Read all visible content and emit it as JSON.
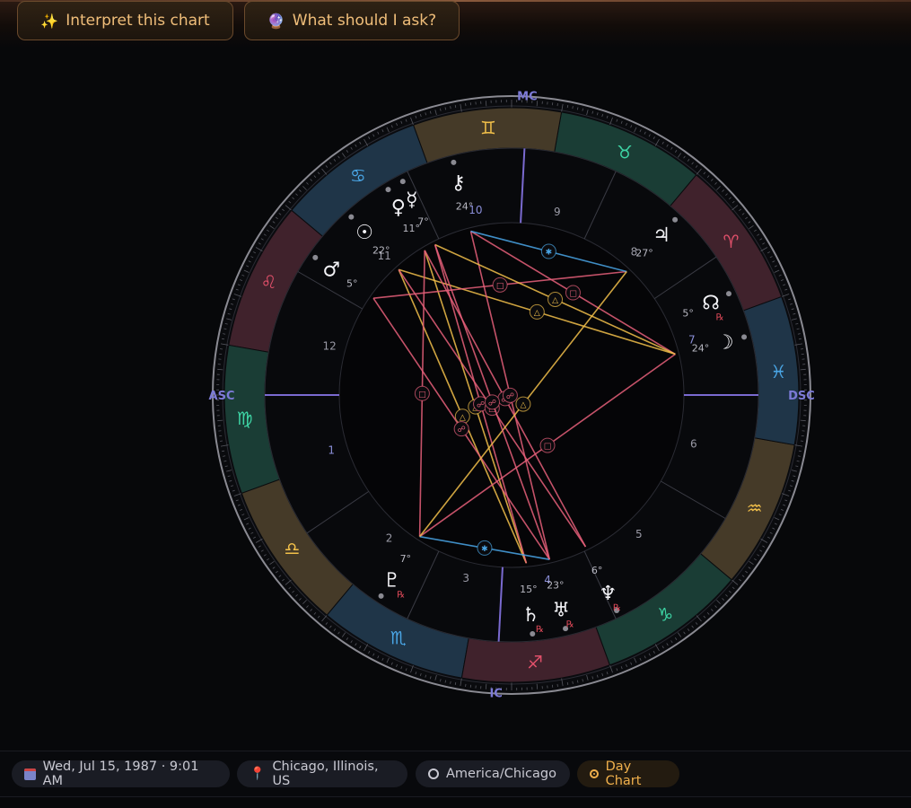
{
  "toolbar": {
    "interpret_icon": "✨",
    "interpret_label": "Interpret this chart",
    "ask_icon": "🔮",
    "ask_label": "What should I ask?"
  },
  "chart": {
    "axes": {
      "mc": "MC",
      "ic": "IC",
      "asc": "ASC",
      "dsc": "DSC"
    },
    "ascendant_longitude": 160,
    "mc_longitude": 67,
    "zodiac": [
      {
        "glyph": "♈",
        "color": "#e0506a",
        "fill": "#40222c"
      },
      {
        "glyph": "♉",
        "color": "#3ed6a6",
        "fill": "#1a3d35"
      },
      {
        "glyph": "♊",
        "color": "#f2c04a",
        "fill": "#453a28"
      },
      {
        "glyph": "♋",
        "color": "#4aa6e6",
        "fill": "#1f3548"
      },
      {
        "glyph": "♌",
        "color": "#e0506a",
        "fill": "#40222c"
      },
      {
        "glyph": "♍",
        "color": "#3ed6a6",
        "fill": "#1a3d35"
      },
      {
        "glyph": "♎",
        "color": "#f2c04a",
        "fill": "#453a28"
      },
      {
        "glyph": "♏",
        "color": "#4aa6e6",
        "fill": "#1f3548"
      },
      {
        "glyph": "♐",
        "color": "#e0506a",
        "fill": "#40222c"
      },
      {
        "glyph": "♑",
        "color": "#3ed6a6",
        "fill": "#1a3d35"
      },
      {
        "glyph": "♒",
        "color": "#f2c04a",
        "fill": "#453a28"
      },
      {
        "glyph": "♓",
        "color": "#4aa6e6",
        "fill": "#1f3548"
      }
    ],
    "houses": [
      {
        "n": "1",
        "color": "#8a8ed8"
      },
      {
        "n": "2",
        "color": "#9a9aa6"
      },
      {
        "n": "3",
        "color": "#9a9aa6"
      },
      {
        "n": "4",
        "color": "#8a8ed8"
      },
      {
        "n": "5",
        "color": "#9a9aa6"
      },
      {
        "n": "6",
        "color": "#9a9aa6"
      },
      {
        "n": "7",
        "color": "#8a8ed8"
      },
      {
        "n": "8",
        "color": "#9a9aa6"
      },
      {
        "n": "9",
        "color": "#9a9aa6"
      },
      {
        "n": "10",
        "color": "#8a8ed8"
      },
      {
        "n": "11",
        "color": "#9a9aa6"
      },
      {
        "n": "12",
        "color": "#9a9aa6"
      }
    ],
    "house_cusps": [
      160,
      194,
      225,
      247,
      275,
      310,
      340,
      14,
      45,
      67,
      95,
      130
    ],
    "planets": [
      {
        "name": "Sun",
        "glyph": "☉",
        "degree": "22°",
        "longitude": 112,
        "retro": false
      },
      {
        "name": "Moon",
        "glyph": "☽",
        "degree": "24°",
        "longitude": 354,
        "retro": false
      },
      {
        "name": "Mercury",
        "glyph": "☿",
        "degree": "7°",
        "longitude": 97,
        "retro": false
      },
      {
        "name": "Venus",
        "glyph": "♀",
        "degree": "11°",
        "longitude": 101,
        "retro": false
      },
      {
        "name": "Mars",
        "glyph": "♂",
        "degree": "5°",
        "longitude": 125,
        "retro": false
      },
      {
        "name": "Jupiter",
        "glyph": "♃",
        "degree": "27°",
        "longitude": 27,
        "retro": false
      },
      {
        "name": "Saturn",
        "glyph": "♄",
        "degree": "15°",
        "longitude": 255,
        "retro": true
      },
      {
        "name": "Uranus",
        "glyph": "♅",
        "degree": "23°",
        "longitude": 263,
        "retro": true
      },
      {
        "name": "Neptune",
        "glyph": "♆",
        "degree": "6°",
        "longitude": 276,
        "retro": true
      },
      {
        "name": "Pluto",
        "glyph": "♇",
        "degree": "7°",
        "longitude": 217,
        "retro": true
      },
      {
        "name": "North Node",
        "glyph": "☊",
        "degree": "5°",
        "longitude": 5,
        "retro": true
      },
      {
        "name": "Chiron",
        "glyph": "⚷",
        "degree": "24°",
        "longitude": 84,
        "retro": false
      }
    ],
    "retro_marker": "℞",
    "aspect_colors": {
      "trine": "#f2c04a",
      "square": "#e8607a",
      "opposition": "#e8607a",
      "sextile": "#4aa6e6"
    },
    "aspect_glyphs": {
      "trine": "△",
      "square": "□",
      "opposition": "☍",
      "sextile": "✱"
    },
    "aspects": [
      {
        "a": "Sun",
        "b": "Moon",
        "type": "trine"
      },
      {
        "a": "Sun",
        "b": "Saturn",
        "type": "trine"
      },
      {
        "a": "Venus",
        "b": "Saturn",
        "type": "trine"
      },
      {
        "a": "Mercury",
        "b": "Saturn",
        "type": "opposition"
      },
      {
        "a": "Venus",
        "b": "Neptune",
        "type": "opposition"
      },
      {
        "a": "Sun",
        "b": "Neptune",
        "type": "square"
      },
      {
        "a": "Mars",
        "b": "Jupiter",
        "type": "square"
      },
      {
        "a": "Mars",
        "b": "Uranus",
        "type": "opposition"
      },
      {
        "a": "Chiron",
        "b": "Uranus",
        "type": "opposition"
      },
      {
        "a": "Chiron",
        "b": "Moon",
        "type": "square"
      },
      {
        "a": "Pluto",
        "b": "Moon",
        "type": "square"
      },
      {
        "a": "Pluto",
        "b": "Venus",
        "type": "square"
      },
      {
        "a": "Chiron",
        "b": "Jupiter",
        "type": "sextile"
      },
      {
        "a": "Pluto",
        "b": "Uranus",
        "type": "sextile"
      },
      {
        "a": "Mercury",
        "b": "Moon",
        "type": "trine"
      },
      {
        "a": "Jupiter",
        "b": "Pluto",
        "type": "trine"
      },
      {
        "a": "Mercury",
        "b": "Uranus",
        "type": "opposition"
      }
    ]
  },
  "footer": {
    "date": "Wed, Jul 15, 1987 · 9:01 AM",
    "place": "Chicago, Illinois, US",
    "timezone": "America/Chicago",
    "day_chart": "Day Chart"
  }
}
